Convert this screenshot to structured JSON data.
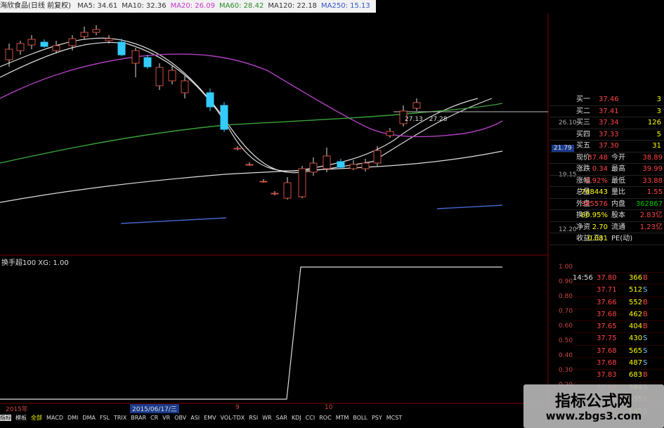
{
  "header": {
    "stock": "海欣食品(日线 前复权)",
    "ma": [
      {
        "label": "MA5: 34.61",
        "color": "#333333"
      },
      {
        "label": "MA10: 32.36",
        "color": "#333333"
      },
      {
        "label": "MA20: 26.09",
        "color": "#cc33cc"
      },
      {
        "label": "MA60: 28.42",
        "color": "#2a8a2a"
      },
      {
        "label": "MA120: 22.18",
        "color": "#333333"
      },
      {
        "label": "MA250: 15.13",
        "color": "#3355cc"
      }
    ]
  },
  "price_axis": [
    "26.10",
    "21.79",
    "19.15",
    "12.20"
  ],
  "inline_label": "27.13 - 27.28",
  "indicator": {
    "title": "换手超100 XG: 1.00",
    "axis": [
      "1.00",
      "0.90",
      "0.80",
      "0.70",
      "0.60",
      "0.50",
      "0.40",
      "0.30",
      "0.20",
      "0.10"
    ]
  },
  "quote": {
    "rows": [
      {
        "l": "买一",
        "v": "37.46",
        "n": "3"
      },
      {
        "l": "买二",
        "v": "37.41",
        "n": "3"
      },
      {
        "l": "买三",
        "v": "37.34",
        "n": "126"
      },
      {
        "l": "买四",
        "v": "37.33",
        "n": "5"
      },
      {
        "l": "买五",
        "v": "37.30",
        "n": "31"
      }
    ],
    "stats": [
      {
        "l1": "现价",
        "v1": "37.48",
        "l2": "今开",
        "v2": "38.89"
      },
      {
        "l1": "涨跌",
        "v1": "0.34",
        "l2": "最高",
        "v2": "39.99"
      },
      {
        "l1": "涨幅",
        "v1": "0.92%",
        "l2": "最低",
        "v2": "33.88"
      },
      {
        "l1": "总量",
        "v1": "748443",
        "l2": "量比",
        "v2": "1.55"
      },
      {
        "l1": "外盘",
        "v1": "385576",
        "l2": "内盘",
        "v2": "362867"
      },
      {
        "l1": "换手",
        "v1": "60.95%",
        "l2": "股本",
        "v2": "2.83亿"
      },
      {
        "l1": "净资",
        "v1": "2.70",
        "l2": "流通",
        "v2": "1.23亿"
      },
      {
        "l1": "收益(三)",
        "v1": "0.081",
        "l2": "PE(动)",
        "v2": ""
      }
    ]
  },
  "trades": [
    {
      "t": "14:56",
      "p": "37.80",
      "v": "366",
      "s": "B"
    },
    {
      "t": "",
      "p": "37.71",
      "v": "512",
      "s": "S"
    },
    {
      "t": "",
      "p": "37.66",
      "v": "552",
      "s": "B"
    },
    {
      "t": "",
      "p": "37.68",
      "v": "462",
      "s": "B"
    },
    {
      "t": "",
      "p": "37.65",
      "v": "404",
      "s": "B"
    },
    {
      "t": "",
      "p": "37.75",
      "v": "430",
      "s": "S"
    },
    {
      "t": "",
      "p": "37.68",
      "v": "565",
      "s": "S"
    },
    {
      "t": "",
      "p": "37.68",
      "v": "487",
      "s": "S"
    },
    {
      "t": "",
      "p": "37.83",
      "v": "683",
      "s": "B"
    },
    {
      "t": "",
      "p": "37.68",
      "v": "584",
      "s": "S"
    },
    {
      "t": "",
      "p": "37.68",
      "v": "535",
      "s": "B"
    },
    {
      "t": "",
      "p": "37.78",
      "v": "642",
      "s": "S"
    }
  ],
  "timeline": {
    "year": "2015年",
    "date": "2015/06/17/三",
    "m9": "9",
    "m10": "10"
  },
  "tabs": [
    "指标",
    "模板",
    "全部",
    "MACD",
    "DMI",
    "DMA",
    "FSL",
    "TRIX",
    "BRAR",
    "CR",
    "VR",
    "OBV",
    "ASI",
    "EMV",
    "VOL-TDX",
    "RSI",
    "WR",
    "SAR",
    "KDJ",
    "CCI",
    "ROC",
    "MTM",
    "BOLL",
    "PSY",
    "MCST"
  ],
  "watermark": {
    "title": "指标公式网",
    "url": "www.zbgs3.com"
  }
}
